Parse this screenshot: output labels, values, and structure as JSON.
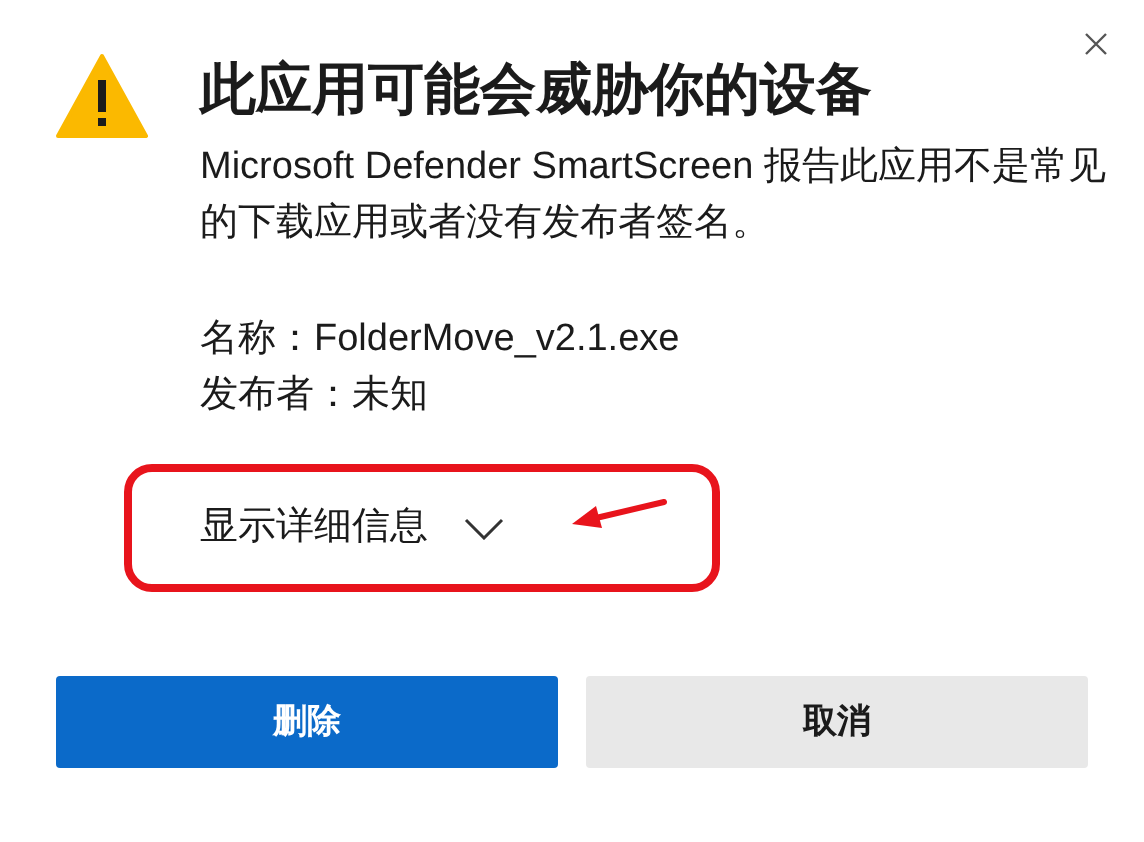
{
  "dialog": {
    "title": "此应用可能会威胁你的设备",
    "message": "Microsoft Defender SmartScreen 报告此应用不是常见的下载应用或者没有发布者签名。",
    "info_lines": [
      "名称：FolderMove_v2.1.exe",
      "发布者：未知"
    ],
    "details_toggle": {
      "label": "显示详细信息",
      "expanded": false
    },
    "buttons": [
      {
        "label": "删除",
        "kind": "primary"
      },
      {
        "label": "取消",
        "kind": "secondary"
      }
    ]
  }
}
